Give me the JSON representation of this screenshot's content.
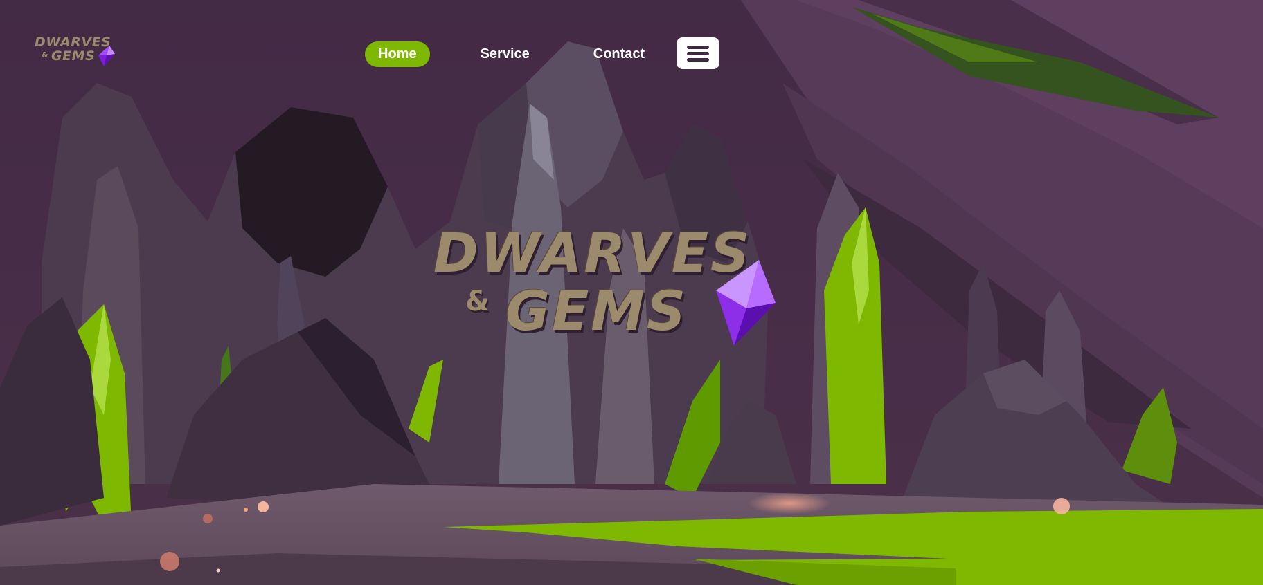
{
  "brand": {
    "line1": "Dwarves",
    "amp": "&",
    "line2": "Gems"
  },
  "nav": {
    "items": [
      {
        "label": "Home",
        "active": true
      },
      {
        "label": "Service",
        "active": false
      },
      {
        "label": "Contact",
        "active": false
      }
    ],
    "menu_icon": "hamburger-menu-icon"
  },
  "hero": {
    "line1": "Dwarves",
    "amp": "&",
    "line2": "Gems",
    "gem_icon": "purple-gem-icon"
  },
  "colors": {
    "background": "#432a45",
    "accent_green": "#7fb800",
    "logo_text": "#9c8a6c",
    "gem_purple": "#9a2fe8",
    "nav_text": "#ffffff",
    "menu_button_bg": "#ffffff"
  }
}
